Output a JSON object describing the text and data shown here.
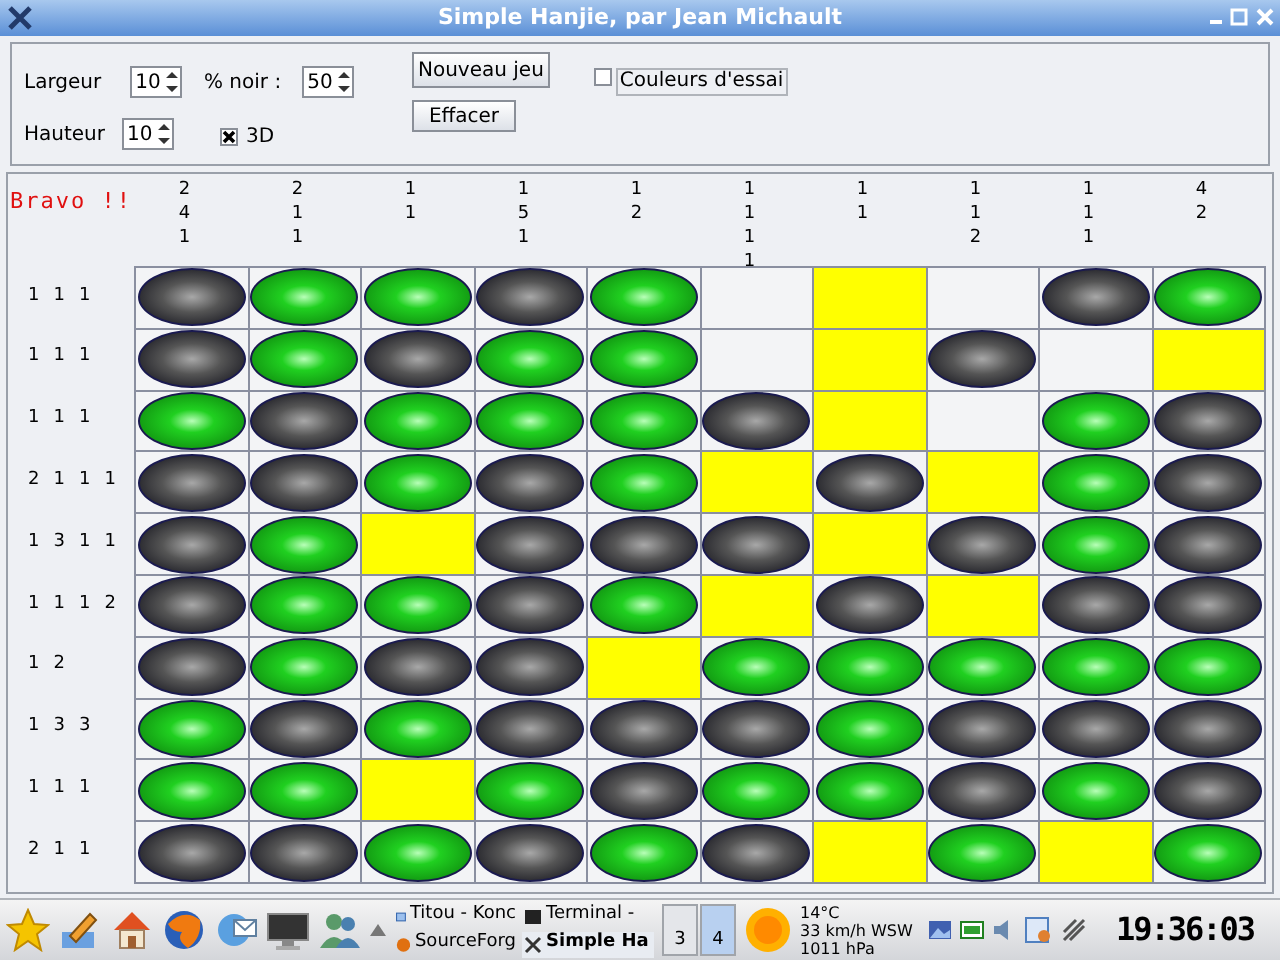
{
  "window": {
    "title": "Simple Hanjie, par Jean Michault"
  },
  "controls": {
    "width_label": "Largeur",
    "width_value": "10",
    "black_label": "% noir :",
    "black_value": "50",
    "height_label": "Hauteur",
    "height_value": "10",
    "new_game": "Nouveau jeu",
    "clear": "Effacer",
    "three_d": {
      "label": "3D",
      "checked": true
    },
    "trial_colors": {
      "label": "Couleurs d'essai",
      "checked": false
    }
  },
  "board": {
    "message": "Bravo !!",
    "column_clues": [
      [
        "2",
        "4",
        "1"
      ],
      [
        "2",
        "1",
        "1"
      ],
      [
        "1",
        "1"
      ],
      [
        "1",
        "5",
        "1"
      ],
      [
        "1",
        "2"
      ],
      [
        "1",
        "1",
        "1",
        "1"
      ],
      [
        "1",
        "1"
      ],
      [
        "1",
        "1",
        "2"
      ],
      [
        "1",
        "1",
        "1"
      ],
      [
        "4",
        "2"
      ]
    ],
    "rows": [
      {
        "clues": [
          "1",
          "1",
          "1"
        ],
        "cells": [
          {
            "kind": "black"
          },
          {
            "kind": "green"
          },
          {
            "kind": "green"
          },
          {
            "kind": "black"
          },
          {
            "kind": "green"
          },
          {
            "kind": "empty"
          },
          {
            "kind": "yellow"
          },
          {
            "kind": "empty"
          },
          {
            "kind": "black"
          },
          {
            "kind": "green"
          }
        ]
      },
      {
        "clues": [
          "1",
          "1",
          "1"
        ],
        "cells": [
          {
            "kind": "black"
          },
          {
            "kind": "green"
          },
          {
            "kind": "black"
          },
          {
            "kind": "green"
          },
          {
            "kind": "green"
          },
          {
            "kind": "empty"
          },
          {
            "kind": "yellow"
          },
          {
            "kind": "black"
          },
          {
            "kind": "empty"
          },
          {
            "kind": "yellow"
          }
        ]
      },
      {
        "clues": [
          "1",
          "1",
          "1"
        ],
        "cells": [
          {
            "kind": "green"
          },
          {
            "kind": "black"
          },
          {
            "kind": "green"
          },
          {
            "kind": "green"
          },
          {
            "kind": "green"
          },
          {
            "kind": "black"
          },
          {
            "kind": "yellow"
          },
          {
            "kind": "empty"
          },
          {
            "kind": "green"
          },
          {
            "kind": "black"
          }
        ]
      },
      {
        "clues": [
          "2",
          "1",
          "1",
          "1"
        ],
        "cells": [
          {
            "kind": "black"
          },
          {
            "kind": "black"
          },
          {
            "kind": "green"
          },
          {
            "kind": "black"
          },
          {
            "kind": "green"
          },
          {
            "kind": "yellow"
          },
          {
            "kind": "black"
          },
          {
            "kind": "yellow"
          },
          {
            "kind": "green"
          },
          {
            "kind": "black"
          }
        ]
      },
      {
        "clues": [
          "1",
          "3",
          "1",
          "1"
        ],
        "cells": [
          {
            "kind": "black"
          },
          {
            "kind": "green"
          },
          {
            "kind": "yellow"
          },
          {
            "kind": "black"
          },
          {
            "kind": "black"
          },
          {
            "kind": "black"
          },
          {
            "kind": "yellow"
          },
          {
            "kind": "black"
          },
          {
            "kind": "green"
          },
          {
            "kind": "black"
          }
        ]
      },
      {
        "clues": [
          "1",
          "1",
          "1",
          "2"
        ],
        "cells": [
          {
            "kind": "black"
          },
          {
            "kind": "green"
          },
          {
            "kind": "green"
          },
          {
            "kind": "black"
          },
          {
            "kind": "green"
          },
          {
            "kind": "yellow"
          },
          {
            "kind": "black"
          },
          {
            "kind": "yellow"
          },
          {
            "kind": "black"
          },
          {
            "kind": "black"
          }
        ]
      },
      {
        "clues": [
          "1",
          "2"
        ],
        "cells": [
          {
            "kind": "black"
          },
          {
            "kind": "green"
          },
          {
            "kind": "black"
          },
          {
            "kind": "black"
          },
          {
            "kind": "yellow"
          },
          {
            "kind": "green"
          },
          {
            "kind": "green"
          },
          {
            "kind": "green"
          },
          {
            "kind": "green"
          },
          {
            "kind": "green"
          }
        ]
      },
      {
        "clues": [
          "1",
          "3",
          "3"
        ],
        "cells": [
          {
            "kind": "green"
          },
          {
            "kind": "black"
          },
          {
            "kind": "green"
          },
          {
            "kind": "black"
          },
          {
            "kind": "black"
          },
          {
            "kind": "black"
          },
          {
            "kind": "green"
          },
          {
            "kind": "black"
          },
          {
            "kind": "black"
          },
          {
            "kind": "black"
          }
        ]
      },
      {
        "clues": [
          "1",
          "1",
          "1"
        ],
        "cells": [
          {
            "kind": "green"
          },
          {
            "kind": "green"
          },
          {
            "kind": "yellow"
          },
          {
            "kind": "green"
          },
          {
            "kind": "black"
          },
          {
            "kind": "green"
          },
          {
            "kind": "green"
          },
          {
            "kind": "black"
          },
          {
            "kind": "green"
          },
          {
            "kind": "black"
          }
        ]
      },
      {
        "clues": [
          "2",
          "1",
          "1"
        ],
        "cells": [
          {
            "kind": "black"
          },
          {
            "kind": "black"
          },
          {
            "kind": "green"
          },
          {
            "kind": "black"
          },
          {
            "kind": "green"
          },
          {
            "kind": "black"
          },
          {
            "kind": "yellow"
          },
          {
            "kind": "green"
          },
          {
            "kind": "yellow"
          },
          {
            "kind": "green"
          }
        ]
      }
    ]
  },
  "taskbar": {
    "tasks": [
      {
        "label": "Titou - Konc",
        "selected": false
      },
      {
        "label": "Terminal -",
        "selected": false
      },
      {
        "label": "SourceForg",
        "selected": false
      },
      {
        "label": "Simple Ha",
        "selected": true
      }
    ],
    "pager": [
      {
        "label": "3",
        "selected": false
      },
      {
        "label": "4",
        "selected": true
      }
    ],
    "weather": [
      "14°C",
      "33 km/h WSW",
      "1011 hPa"
    ],
    "clock": "19:36:03"
  }
}
